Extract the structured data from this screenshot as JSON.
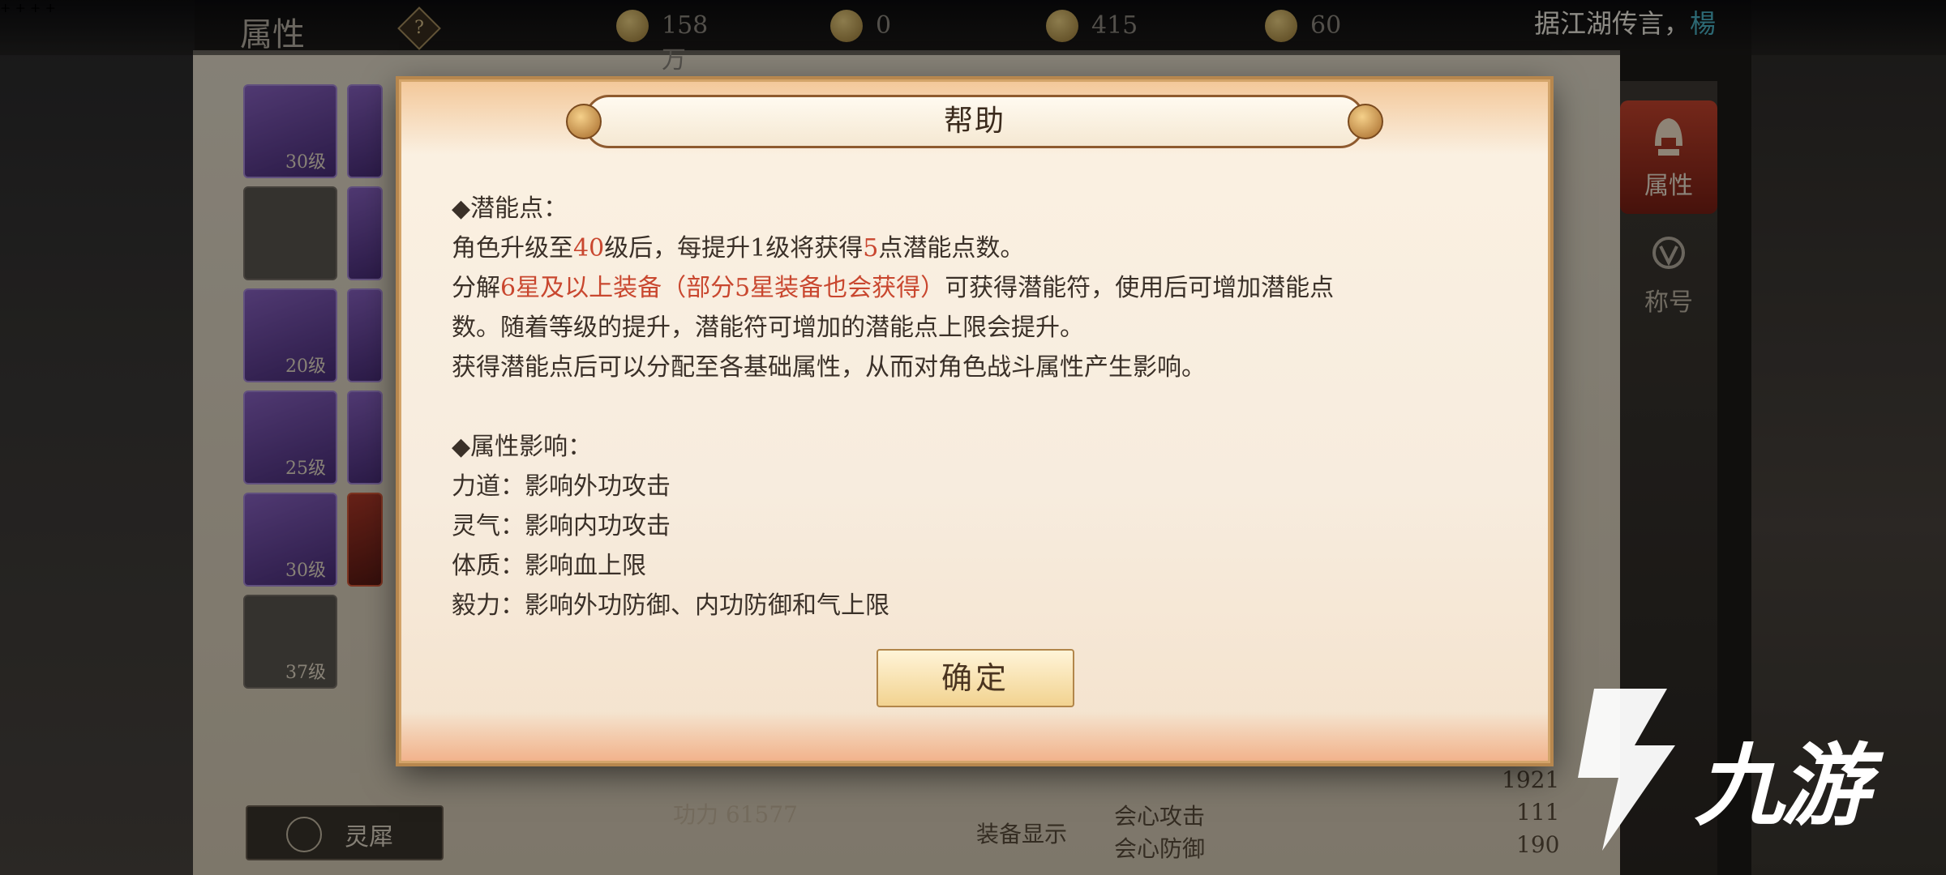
{
  "topbar": {
    "title": "属性",
    "help_symbol": "?",
    "resources": [
      {
        "icon": "coin-icon",
        "value": "158万"
      },
      {
        "icon": "ingot-icon",
        "value": "0"
      },
      {
        "icon": "treasure-icon",
        "value": "415"
      },
      {
        "icon": "gold-bar-icon",
        "value": "60"
      }
    ],
    "plus_symbol": "+",
    "rumor_prefix": "据江湖传言，",
    "rumor_name": "楊"
  },
  "background": {
    "slot_levels": [
      "30级",
      "20级",
      "25级",
      "30级",
      "37级"
    ],
    "lingxi_label": "灵犀",
    "bottom_texts": [
      "功力 61577",
      "装备显示",
      "会心攻击",
      "会心防御"
    ],
    "bottom_numbers": [
      "1921",
      "111",
      "190"
    ]
  },
  "side_tabs": [
    {
      "label": "属性",
      "active": true
    },
    {
      "label": "称号",
      "active": false
    }
  ],
  "dialog": {
    "title": "帮助",
    "section1_header": "◆潜能点：",
    "line1_a": "角色升级至",
    "line1_b": "40",
    "line1_c": "级后，每提升1级将获得",
    "line1_d": "5",
    "line1_e": "点潜能点数。",
    "line2_a": "分解",
    "line2_b": "6星及以上装备（部分5星装备也会获得）",
    "line2_c": "可获得潜能符，使用后可增加潜能点",
    "line3": "数。随着等级的提升，潜能符可增加的潜能点上限会提升。",
    "line4": "获得潜能点后可以分配至各基础属性，从而对角色战斗属性产生影响。",
    "section2_header": "◆属性影响：",
    "attrs": [
      "力道：影响外功攻击",
      "灵气：影响内功攻击",
      "体质：影响血上限",
      "毅力：影响外功防御、内功防御和气上限"
    ],
    "confirm_label": "确定"
  },
  "watermark": {
    "text": "九游"
  },
  "colors": {
    "highlight": "#c9472f",
    "rumor_name": "#4db5c9",
    "active_tab": "#c9452e"
  }
}
